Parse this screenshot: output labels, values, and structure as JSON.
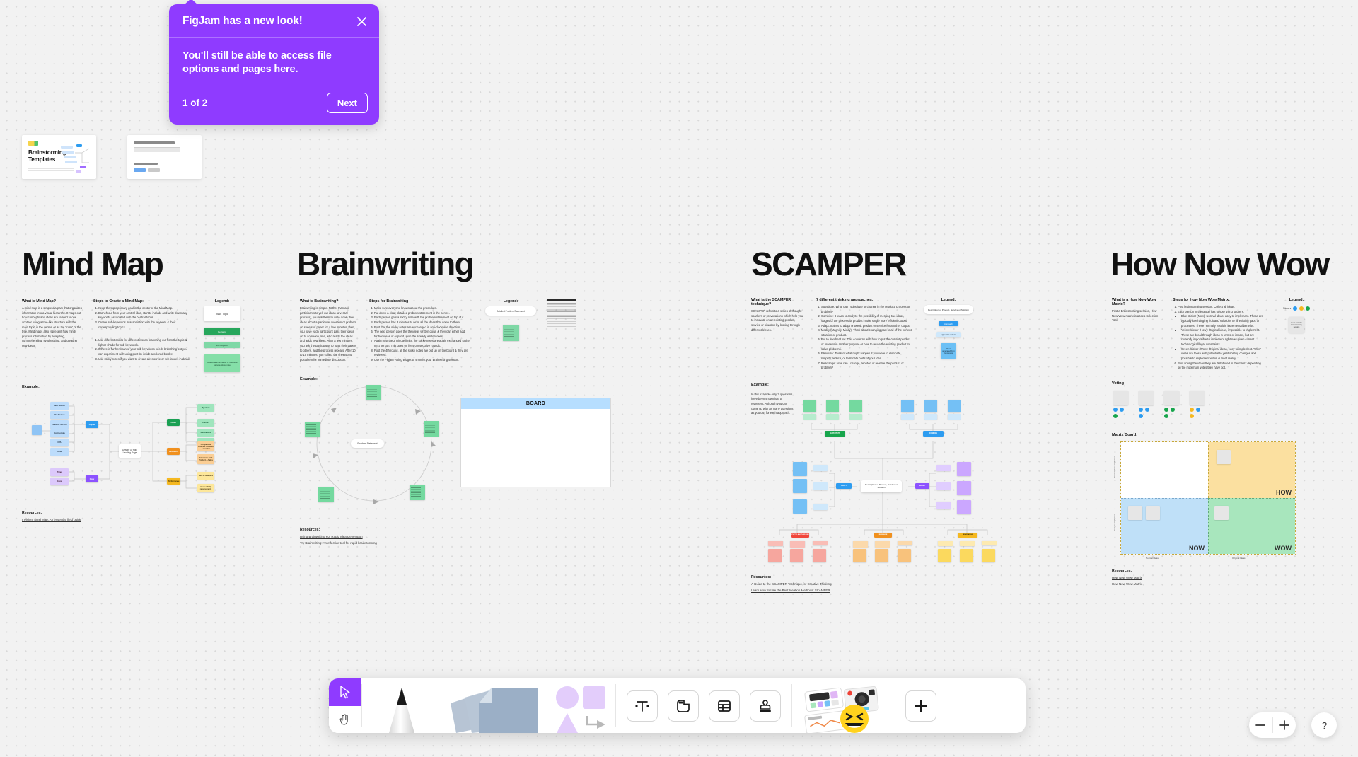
{
  "tooltip": {
    "title": "FigJam has a new look!",
    "body": "You'll still be able to access file options and pages here.",
    "counter": "1 of 2",
    "next_label": "Next",
    "close_icon": "close-icon",
    "accent": "#8f3bff"
  },
  "thumbnails": [
    {
      "title": "Brainstorming Templates",
      "subtitle": "A collection of templates to help you run better brainstorms."
    },
    {
      "title": "Doing offline brainstorming?",
      "subtitle": "Here's how to get the most out of your offline session using these templates.",
      "cta": "Find the course here",
      "chips": [
        "Course",
        "Figma"
      ]
    }
  ],
  "sections": [
    {
      "id": "mind-map",
      "title": "Mind Map",
      "what_head": "What is Mind Map?",
      "what_body": "A mind map is a simple diagram that organizes information into a visual hierarchy. It maps out how concepts and ideas are related to one another using a tree-like structure with the main topic in the center, or as the 'trunk' of the tree. Mind maps also represent how minds process information by analyzing, comprehending, synthesizing, and creating new ideas.",
      "steps_head": "Steps to Create a Mind Map:",
      "steps": [
        "Keep the topic primary goal in the center of the Mind Map.",
        "Branch out from your central idea, start to include and write down any keywords associated with the central focus.",
        "Create sub-keywords in association with the keyword & their corresponding topics.",
        "Use different colors for different issues branching out from the topic & lighter shade for sub-keywords.",
        "If there is further chance your sub-keywords needs branching out you can experiment with using post-its inside a colored border.",
        "Use sticky notes if you want to create a resource or see issues in detail."
      ],
      "legend_head": "Legend:",
      "legend": [
        {
          "label": "Main Topic",
          "color": "#ffffff"
        },
        {
          "label": "Keyword",
          "color": "#26a65b"
        },
        {
          "label": "Sub Keyword",
          "color": "#7fd8a6"
        },
        {
          "label": "Additional information or resource using a sticky note",
          "color": "#85dfa8"
        }
      ],
      "example_label": "Example:",
      "resources_label": "Resources:",
      "resources": [
        "Invision: Mind Map: An essential field guide"
      ],
      "diagram": {
        "center": "Design Or solo Landing Page",
        "hub_left": {
          "label": "Layout",
          "color": "#2d9cf0"
        },
        "hub_left2": {
          "label": "Copy",
          "color": "#8c52ff"
        },
        "left_nodes": [
          "Hero Section",
          "Nav Section",
          "Features Section",
          "Testimonials",
          "CTA",
          "Footer"
        ],
        "left_nodes2": [
          "Tone",
          "Copy"
        ],
        "branches": [
          {
            "label": "Visual",
            "color": "#1aa053",
            "children": [
              "Typeface",
              "Colours",
              "Illustrations",
              "Iconography"
            ]
          },
          {
            "label": "Research",
            "color": "#f0901e",
            "children": [
              "Competitive analysis research & insights",
              "Interviews with Product & Sales"
            ]
          },
          {
            "label": "Performance",
            "color": "#f5b820",
            "children": [
              "SEO & Analytics",
              "Accessibility requirements"
            ]
          }
        ]
      }
    },
    {
      "id": "brainwriting",
      "title": "Brainwriting",
      "what_head": "What is Brainwriting?",
      "what_body": "Brainwriting is simple. Rather than ask participants to yell out ideas (a verbal process), you ask them to write down their ideas about a particular question or problem on sheets of paper for a few minutes; then, you have each participant pass their ideas on to someone else, who reads the ideas and adds new ideas. After a few minutes, you ask the participants to pass their papers to others, and the process repeats. After 10 to 15 minutes, you collect the sheets and post them for immediate discussion.",
      "steps_head": "Steps for Brainwriting",
      "steps": [
        "Make sure everyone knows about the procedure.",
        "Put down a clear, detailed problem statement in the centre.",
        "Each person gets a sticky note with the problem statement on top of it.",
        "Each person has 3 minutes to write all the ideas that come to them.",
        "Post that the sticky notes are exchanged in anti-clockwise direction.",
        "The next person goes the the ideas written down & they can either add further ideas or expand upon the already written ones.",
        "Again post the 2 minute limits, the sticky notes are again exchanged to the next person. This goes on for 4 consecutive rounds.",
        "Post the 4th round, all the sticky notes are put up on the board & they are reviewed.",
        "Use the Figjam voting widget to shortlist your Brainwriting solution."
      ],
      "legend_head": "Legend:",
      "legend": [
        {
          "label": "Detailed Problem Statement",
          "color": "#ffffff"
        },
        {
          "label": "Problem Statement 1. Idea 1 2. Idea 2 3. Idea 3 4. Idea 4",
          "color": "#7fd8a6"
        }
      ],
      "example_label": "Example:",
      "center_label": "Problem Statement",
      "board_label": "BOARD",
      "resources_label": "Resources:",
      "resources": [
        "Using Brainwriting For Rapid Idea Generation",
        "Try Brainwriting: An effective tool for rapid brainstorming"
      ]
    },
    {
      "id": "scamper",
      "title": "SCAMPER",
      "what_head": "What is the SCAMPER technique?",
      "what_body": "SCAMPER refers to a series of thought sparkers or provocations which help you to innovate on an existing product, service or situation by looking through different lenses.",
      "steps_head": "7 different thinking approaches:",
      "steps": [
        "Substitute: What can I substitute or change in the product, process or problem?",
        "Combine: It leads to analyze the possibility of merging two ideas, stages of the process or product in one single more efficient output.",
        "Adapt: It aims to adapt or tweak product or service for another output.",
        "Modify (Magnify, Minify): Think about changing part or all of the current situation or product.",
        "Put to Another Use: This concerns with how to put the current product or process in another purpose or how to reuse the existing product to solve problems.",
        "Eliminate: Think of what might happen if you were to eliminate, simplify, reduce, or terminate parts of your idea.",
        "Rearrange: How can I change, reorder, or reverse the product or problem?"
      ],
      "legend_head": "Legend:",
      "legend": [
        {
          "label": "Description of Product, Service or Solution",
          "color": "#ffffff"
        },
        {
          "label": "Approach",
          "color": "#2d9cf0"
        },
        {
          "label": "Question asked",
          "color": "#cfe8fb"
        },
        {
          "label": "Ideas generated from the question",
          "color": "#6cc0f5"
        }
      ],
      "example_label": "Example:",
      "example_body": "In this example only 3 questions have been shown just to represent. Although you can come up with as many questions as you can for each approach.",
      "center_label": "Description of Product, Service or Solution",
      "approaches": [
        {
          "label": "SUBSTITUTE",
          "color": "#17a54c",
          "note": "#7fd8a6"
        },
        {
          "label": "COMBINE",
          "color": "#2d9cf0",
          "note": "#6cc0f5"
        },
        {
          "label": "ADAPT",
          "color": "#2d9cf0",
          "note": "#6cc0f5"
        },
        {
          "label": "MODIFY",
          "color": "#8c52ff",
          "note": "#cba7ff"
        },
        {
          "label": "PUT TO ANOTHER USE",
          "color": "#f0453a",
          "note": "#f6a69e"
        },
        {
          "label": "ELIMINATE",
          "color": "#f0901e",
          "note": "#f8c27c"
        },
        {
          "label": "REARRANGE",
          "color": "#f5b820",
          "note": "#fbd95e"
        }
      ],
      "resources_label": "Resources:",
      "resources": [
        "A Guide to the SCAMPER Technique for Creative Thinking",
        "Learn How to Use the Best Ideation Methods: SCAMPER"
      ]
    },
    {
      "id": "how-now-wow",
      "title": "How Now Wow",
      "what_head": "What is a How Now Wow Matrix?",
      "what_body": "Post a Brainstorming session, How Now Wow matrix is a Idea Selection Tool.",
      "steps_head": "Steps for How Now Wow Matrix:",
      "steps": [
        "Post brainstorming session, Collect all ideas.",
        "Each person in the group has to vote using stickers.",
        "Blue sticker (Now): Normal ideas, easy to implement. These are typically low-hanging fruit and solutions to fill existing gaps or processes. These normally result in incremental benefits.",
        "Yellow sticker (How): Original ideas, impossible to implement. These are breakthrough ideas in terms of impact, but are currently impossible to implement right now given current technological/legal constraints.",
        "Green sticker (Wow): Original ideas, easy to implement. 'Wow' ideas are those with potential to yield shifting changes and possible to implement within current reality.",
        "Post voting the ideas they are distributed in the matrix depending on the maximum votes they have got."
      ],
      "legend_head": "Legend:",
      "legend_vote_label": "Stickers",
      "legend_vote_colors": [
        "#2d9cf0",
        "#f5b820",
        "#17a54c"
      ],
      "legend_note_label": "Ideas from the brainstorming session",
      "voting_label": "Voting",
      "matrix_label": "Matrix Board:",
      "quadrants": [
        {
          "label": "HOW",
          "color": "#fbe0a0"
        },
        {
          "label": "NOW",
          "color": "#bfe0f8"
        },
        {
          "label": "WOW",
          "color": "#a8e6bd"
        },
        {
          "label": "",
          "color": "#ffffff"
        }
      ],
      "axis_y_top": "Impossible to implement",
      "axis_y_bottom": "Easy to implement",
      "axis_x_left": "Normal Ideas",
      "axis_x_right": "Original Ideas",
      "resources_label": "Resources:",
      "resources": [
        "How Now Wow Matrix",
        "How Now Wow Matrix"
      ]
    }
  ],
  "toolbar": {
    "tools": [
      {
        "name": "cursor-tool",
        "icon": "cursor-icon",
        "active": true
      },
      {
        "name": "hand-tool",
        "icon": "hand-icon",
        "active": false
      },
      {
        "name": "pen-tool",
        "icon": "pen-icon"
      },
      {
        "name": "sticky-note-tool",
        "icon": "sticky-note-icon"
      },
      {
        "name": "shapes-tool",
        "icon": "shapes-icon"
      },
      {
        "name": "text-tool",
        "icon": "text-icon"
      },
      {
        "name": "section-tool",
        "icon": "section-icon"
      },
      {
        "name": "table-tool",
        "icon": "table-icon"
      },
      {
        "name": "stamp-tool",
        "icon": "stamp-icon"
      },
      {
        "name": "widgets-tool",
        "icon": "widgets-icon"
      },
      {
        "name": "more-tool",
        "icon": "plus-icon"
      }
    ]
  },
  "viewport": {
    "zoom_out_icon": "minus-icon",
    "zoom_in_icon": "plus-icon",
    "help_icon": "question-icon"
  }
}
